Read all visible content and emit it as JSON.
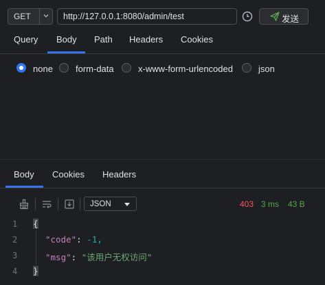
{
  "request": {
    "method": "GET",
    "url": "http://127.0.0.1:8080/admin/test",
    "send_label": "发送"
  },
  "request_tabs": [
    "Query",
    "Body",
    "Path",
    "Headers",
    "Cookies"
  ],
  "body_types": [
    "none",
    "form-data",
    "x-www-form-urlencoded",
    "json"
  ],
  "body_type_selected": "none",
  "response_tabs": [
    "Body",
    "Cookies",
    "Headers"
  ],
  "response": {
    "format": "JSON",
    "status_code": "403",
    "time": "3 ms",
    "size": "43 B"
  },
  "code_lines": [
    {
      "num": "1",
      "text": "{"
    },
    {
      "num": "2",
      "key": "\"code\"",
      "value": "-1,"
    },
    {
      "num": "3",
      "key": "\"msg\"",
      "value": "\"该用户无权访问\""
    },
    {
      "num": "4",
      "text": "}"
    }
  ],
  "colors": {
    "accent": "#3574f0",
    "status_error": "#f75464",
    "status_ok": "#57a64a",
    "json_key": "#c77dbb",
    "json_number": "#2aacb8",
    "json_string": "#6aab73"
  },
  "icons": {
    "method_dropdown": "chevron-down-icon",
    "history": "clock-icon",
    "send": "paper-plane-icon",
    "toolbar": [
      "broom-icon",
      "wrap-icon",
      "download-icon"
    ]
  }
}
